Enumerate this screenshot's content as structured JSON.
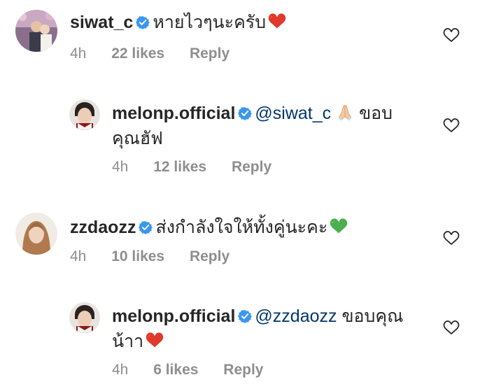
{
  "comments": [
    {
      "username": "siwat_c",
      "text": "หายไวๆนะครับ",
      "emoji": "red-heart",
      "time": "4h",
      "likes": "22 likes",
      "reply": "Reply"
    },
    {
      "username": "melonp.official",
      "mention": "@siwat_c",
      "text_after_emoji": "ขอบ",
      "text_line2": "คุณฮัฟ",
      "emoji": "folded-hands",
      "time": "4h",
      "likes": "12 likes",
      "reply": "Reply"
    },
    {
      "username": "zzdaozz",
      "text": "ส่งกำลังใจให้ทั้งคู่นะคะ",
      "emoji": "green-heart",
      "time": "4h",
      "likes": "10 likes",
      "reply": "Reply"
    },
    {
      "username": "melonp.official",
      "mention": "@zzdaozz",
      "text": "ขอบคุณ",
      "text_line2": "น้าา",
      "emoji": "red-heart",
      "time": "4h",
      "likes": "6 likes",
      "reply": "Reply"
    }
  ],
  "colors": {
    "text": "#262626",
    "meta": "#8e8e8e",
    "mention": "#00376b",
    "verified": "#3897f0",
    "red_heart": "#e0392b",
    "green_heart": "#4caf50"
  }
}
